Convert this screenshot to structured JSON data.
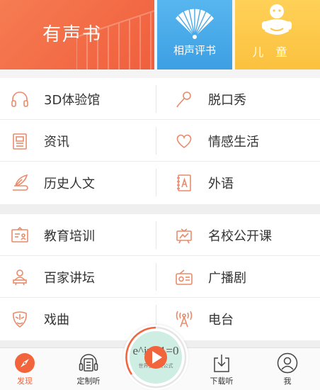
{
  "banner": {
    "audio_book": "有声书",
    "crosstalk": "相声评书",
    "kids": "儿 童"
  },
  "section1": [
    {
      "left": {
        "label": "3D体验馆",
        "icon": "headphones-icon"
      },
      "right": {
        "label": "脱口秀",
        "icon": "microphone-icon"
      }
    },
    {
      "left": {
        "label": "资讯",
        "icon": "newspaper-icon"
      },
      "right": {
        "label": "情感生活",
        "icon": "heart-icon"
      }
    },
    {
      "left": {
        "label": "历史人文",
        "icon": "quill-scroll-icon"
      },
      "right": {
        "label": "外语",
        "icon": "letter-a-book-icon"
      }
    }
  ],
  "section2": [
    {
      "left": {
        "label": "教育培训",
        "icon": "blackboard-icon"
      },
      "right": {
        "label": "名校公开课",
        "icon": "projector-screen-icon"
      }
    },
    {
      "left": {
        "label": "百家讲坛",
        "icon": "lecturer-podium-icon"
      },
      "right": {
        "label": "广播剧",
        "icon": "radio-icon"
      }
    },
    {
      "left": {
        "label": "戏曲",
        "icon": "opera-mask-icon"
      },
      "right": {
        "label": "电台",
        "icon": "radio-tower-icon"
      }
    }
  ],
  "player": {
    "cover_text": "e^iπ+1=0",
    "cover_sub": "世界上最美公式"
  },
  "tabs": [
    {
      "label": "发现",
      "icon": "compass-icon",
      "active": true
    },
    {
      "label": "定制听",
      "icon": "headphone-list-icon",
      "active": false
    },
    {
      "label": "下载听",
      "icon": "download-icon",
      "active": false
    },
    {
      "label": "我",
      "icon": "user-icon",
      "active": false
    }
  ],
  "colors": {
    "accent": "#f2643c",
    "audio_tile": "#f26a45",
    "crosstalk_tile": "#47a8e8",
    "kids_tile": "#fcc84a",
    "icon_stroke": "#e98b6b"
  }
}
